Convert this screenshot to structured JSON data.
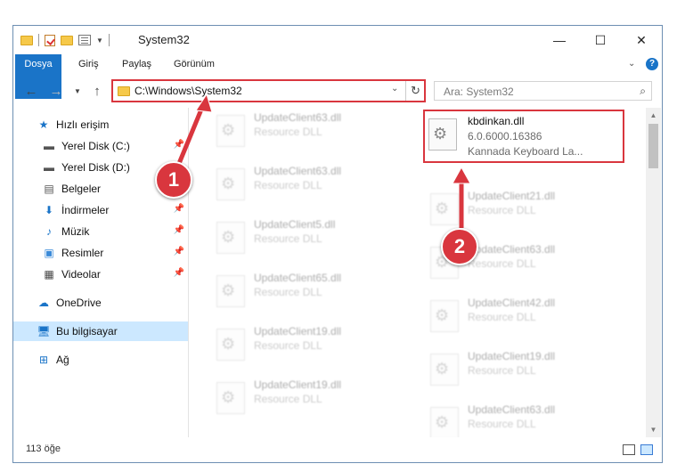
{
  "window": {
    "title": "System32",
    "controls": [
      "—",
      "☐",
      "✕"
    ]
  },
  "ribbon": {
    "tabs": [
      "Dosya",
      "Giriş",
      "Paylaş",
      "Görünüm"
    ]
  },
  "address": {
    "path": "C:\\Windows\\System32",
    "search_placeholder": "Ara: System32"
  },
  "sidebar": {
    "items": [
      {
        "label": "Hızlı erişim",
        "icon": "star-icon"
      },
      {
        "label": "Yerel Disk (C:)",
        "icon": "drive-icon"
      },
      {
        "label": "Yerel Disk (D:)",
        "icon": "drive-icon"
      },
      {
        "label": "Belgeler",
        "icon": "documents-icon"
      },
      {
        "label": "İndirmeler",
        "icon": "download-icon"
      },
      {
        "label": "Müzik",
        "icon": "music-icon"
      },
      {
        "label": "Resimler",
        "icon": "pictures-icon"
      },
      {
        "label": "Videolar",
        "icon": "video-icon"
      },
      {
        "label": "OneDrive",
        "icon": "cloud-icon"
      },
      {
        "label": "Bu bilgisayar",
        "icon": "computer-icon"
      },
      {
        "label": "Ağ",
        "icon": "network-icon"
      }
    ]
  },
  "files": {
    "highlighted": {
      "name": "kbdinkan.dll",
      "version": "6.0.6000.16386",
      "description": "Kannada Keyboard La..."
    },
    "left_column": [
      {
        "name": "UpdateClient63.dll",
        "desc": "Resource DLL"
      },
      {
        "name": "UpdateClient63.dll",
        "desc": "Resource DLL"
      },
      {
        "name": "UpdateClient5.dll",
        "desc": "Resource DLL"
      },
      {
        "name": "UpdateClient65.dll",
        "desc": "Resource DLL"
      },
      {
        "name": "UpdateClient19.dll",
        "desc": "Resource DLL"
      },
      {
        "name": "UpdateClient19.dll",
        "desc": "Resource DLL"
      }
    ],
    "right_column": [
      {
        "name": "UpdateClient21.dll",
        "desc": "Resource DLL"
      },
      {
        "name": "UpdateClient63.dll",
        "desc": "Resource DLL"
      },
      {
        "name": "UpdateClient42.dll",
        "desc": "Resource DLL"
      },
      {
        "name": "UpdateClient19.dll",
        "desc": "Resource DLL"
      },
      {
        "name": "UpdateClient63.dll",
        "desc": "Resource DLL"
      }
    ]
  },
  "status": {
    "count": "113 öğe"
  },
  "annotations": {
    "marker1": "1",
    "marker2": "2"
  },
  "colors": {
    "accent": "#1a74c8",
    "highlight": "#d9363e",
    "selection": "#cce8ff"
  }
}
